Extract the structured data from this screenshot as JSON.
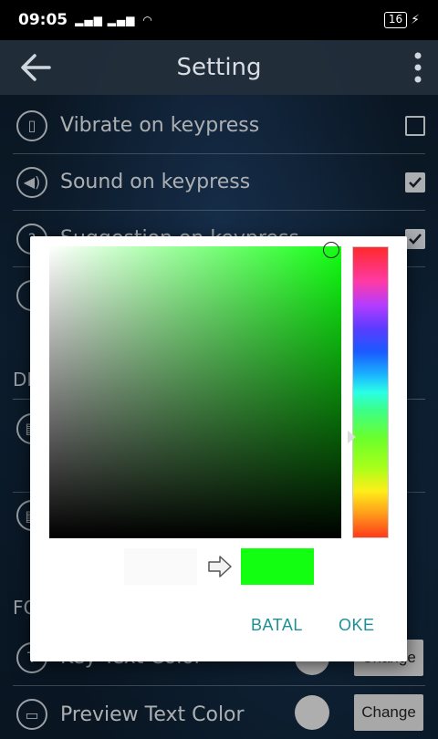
{
  "status": {
    "time": "09:05",
    "signal": "3G 4G",
    "battery": "16"
  },
  "appbar": {
    "title": "Setting"
  },
  "rows": {
    "vibrate": {
      "label": "Vibrate on keypress",
      "checked": false
    },
    "sound": {
      "label": "Sound on keypress",
      "checked": true
    },
    "suggestion": {
      "label": "Suggestion on keypress",
      "checked": true
    }
  },
  "sections": {
    "display_partial": "DI",
    "font_partial": "FO"
  },
  "font_rows": {
    "key_text": {
      "label": "Key Text Color",
      "button": "Change"
    },
    "preview_text": {
      "label": "Preview Text Color",
      "button": "Change"
    }
  },
  "dialog": {
    "selected_color": "#12ff12",
    "previous_color": "#fafafa",
    "cancel_label": "BATAL",
    "ok_label": "OKE"
  },
  "colors": {
    "accent": "#1f8f97",
    "appbar": "#232d3a"
  }
}
